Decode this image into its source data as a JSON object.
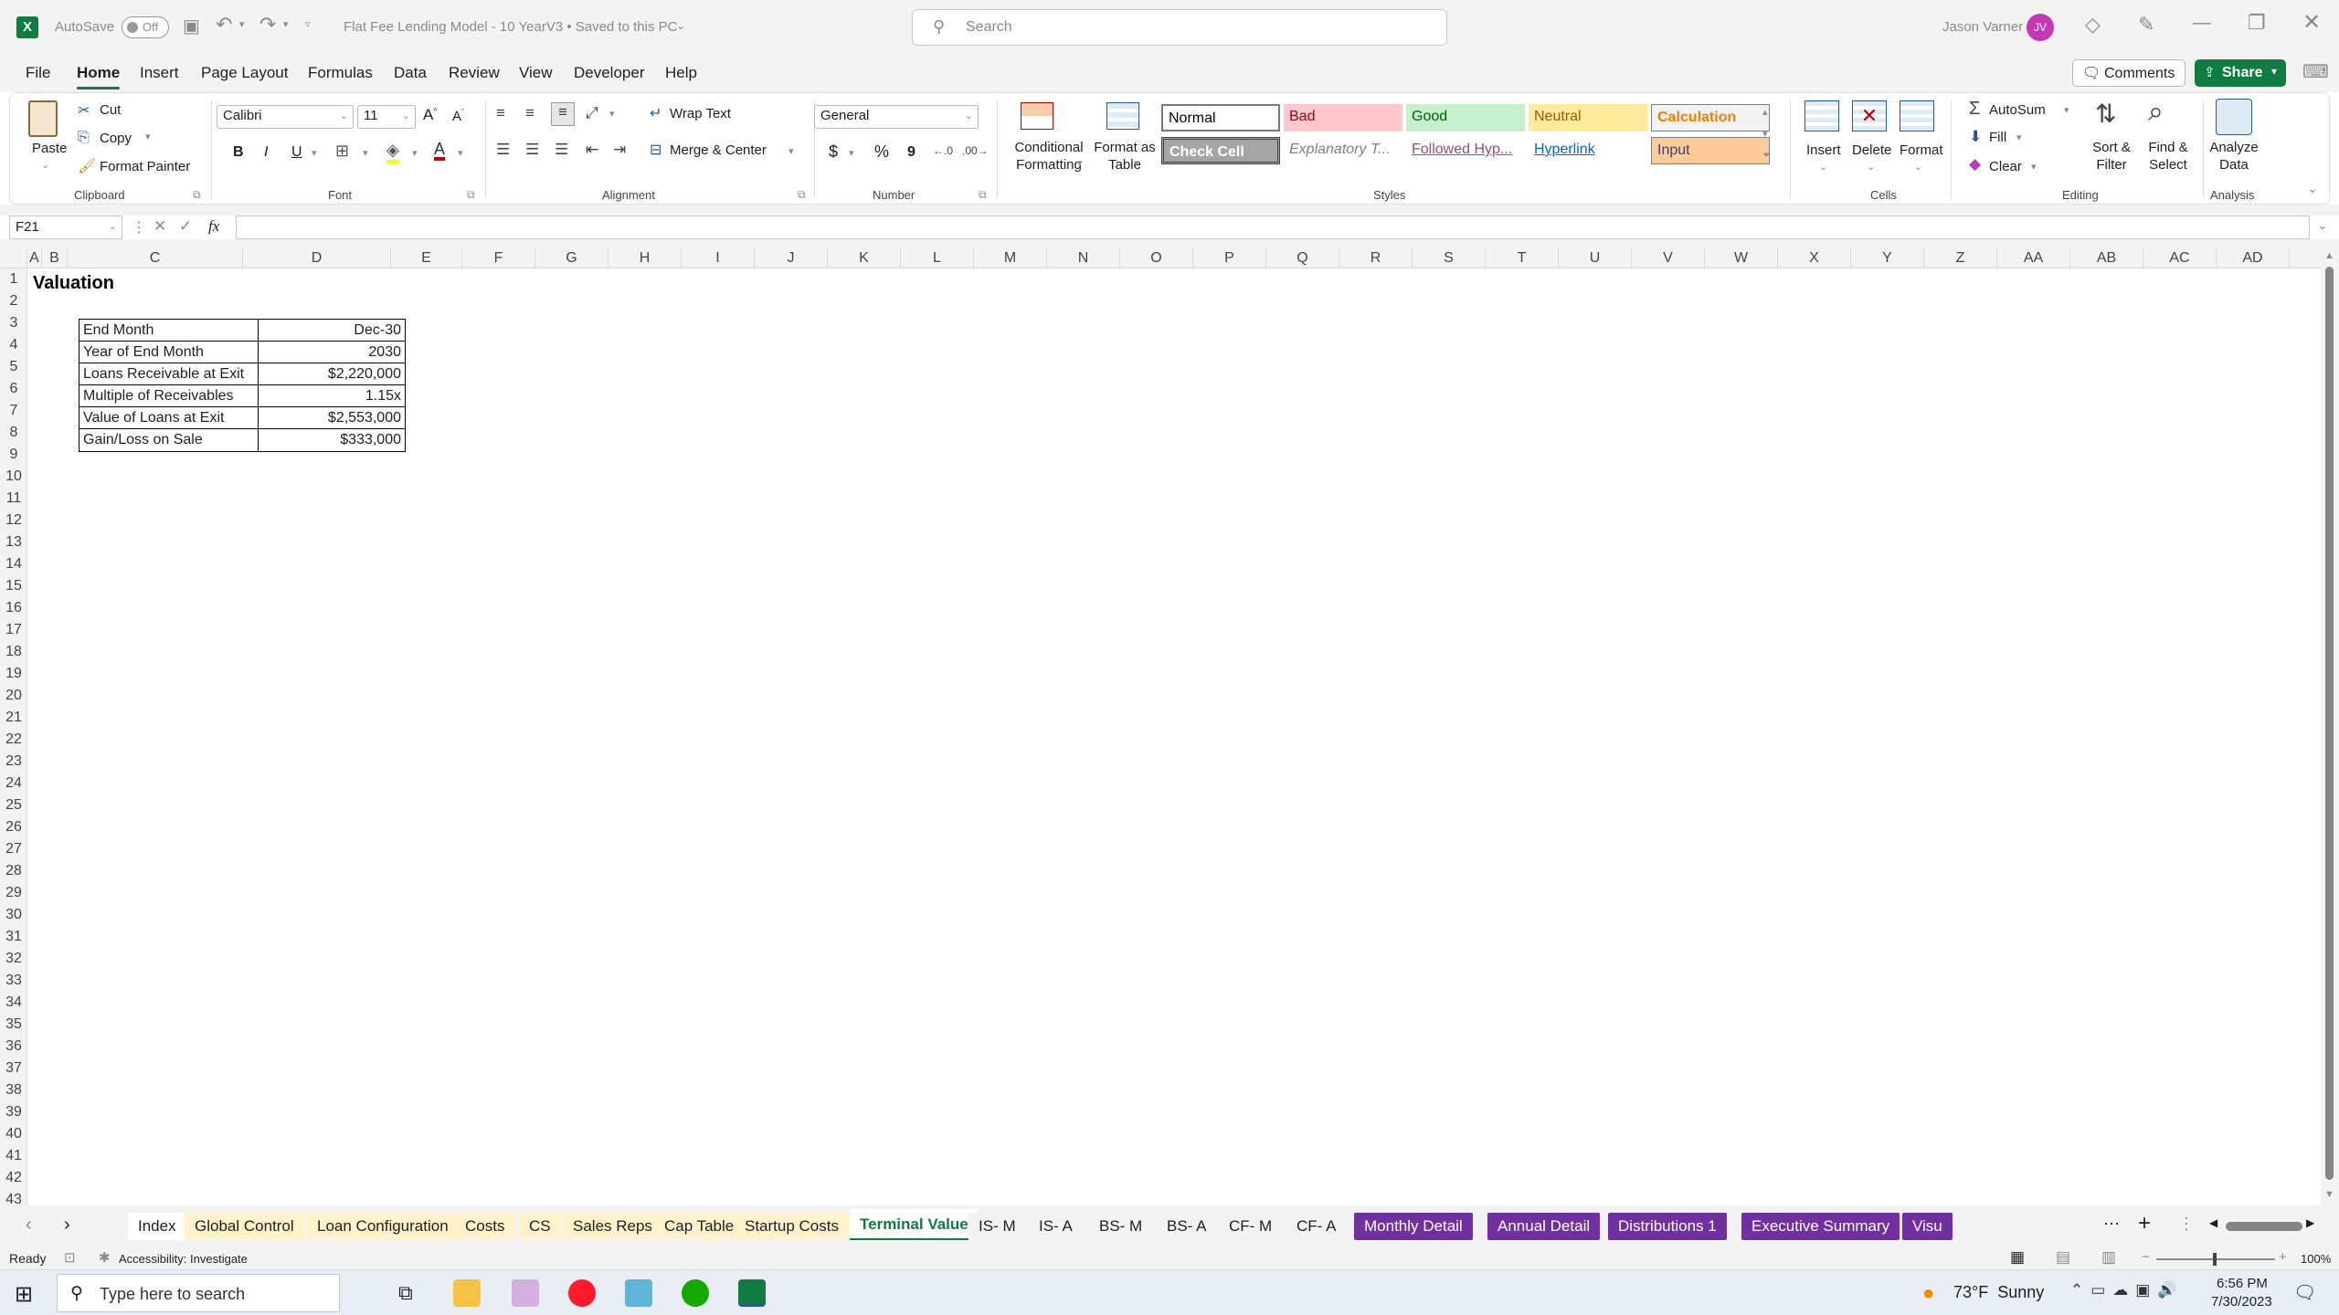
{
  "titlebar": {
    "autosave_label": "AutoSave",
    "autosave_state": "Off",
    "doc_title": "Flat Fee Lending Model - 10 YearV3 • Saved to this PC",
    "search_placeholder": "Search",
    "user_name": "Jason Varner",
    "user_initials": "JV"
  },
  "menu": {
    "items": [
      "File",
      "Home",
      "Insert",
      "Page Layout",
      "Formulas",
      "Data",
      "Review",
      "View",
      "Developer",
      "Help"
    ],
    "active": "Home",
    "comments_label": "Comments",
    "share_label": "Share"
  },
  "ribbon": {
    "clipboard": {
      "paste": "Paste",
      "cut": "Cut",
      "copy": "Copy",
      "format_painter": "Format Painter",
      "group": "Clipboard"
    },
    "font": {
      "name": "Calibri",
      "size": "11",
      "group": "Font",
      "bold": "B",
      "italic": "I",
      "underline": "U"
    },
    "alignment": {
      "wrap": "Wrap Text",
      "merge": "Merge & Center",
      "group": "Alignment"
    },
    "number": {
      "format": "General",
      "group": "Number",
      "currency": "$",
      "percent": "%",
      "comma": "9"
    },
    "styles": {
      "cond": "Conditional Formatting",
      "table": "Format as Table",
      "group": "Styles",
      "cells": [
        {
          "label": "Normal",
          "bg": "#ffffff",
          "fg": "#000000"
        },
        {
          "label": "Bad",
          "bg": "#ffc7ce",
          "fg": "#9c0006"
        },
        {
          "label": "Good",
          "bg": "#c6efce",
          "fg": "#006100"
        },
        {
          "label": "Neutral",
          "bg": "#ffeb9c",
          "fg": "#9c5700"
        },
        {
          "label": "Calculation",
          "bg": "#f2f2f2",
          "fg": "#fa7d00"
        },
        {
          "label": "Check Cell",
          "bg": "#a5a5a5",
          "fg": "#ffffff"
        },
        {
          "label": "Explanatory T...",
          "bg": "#ffffff",
          "fg": "#7f7f7f"
        },
        {
          "label": "Followed Hyp...",
          "bg": "#ffffff",
          "fg": "#954f72"
        },
        {
          "label": "Hyperlink",
          "bg": "#ffffff",
          "fg": "#0563c1"
        },
        {
          "label": "Input",
          "bg": "#ffcc99",
          "fg": "#3f3f76"
        }
      ]
    },
    "cells": {
      "insert": "Insert",
      "delete": "Delete",
      "format": "Format",
      "group": "Cells"
    },
    "editing": {
      "autosum": "AutoSum",
      "fill": "Fill",
      "clear": "Clear",
      "sort": "Sort & Filter",
      "find": "Find & Select",
      "group": "Editing"
    },
    "analysis": {
      "analyze": "Analyze Data",
      "group": "Analysis"
    }
  },
  "formula_bar": {
    "name_box": "F21",
    "fx": "fx",
    "value": ""
  },
  "columns": [
    "A",
    "B",
    "C",
    "D",
    "E",
    "F",
    "G",
    "H",
    "I",
    "J",
    "K",
    "L",
    "M",
    "N",
    "O",
    "P",
    "Q",
    "R",
    "S",
    "T",
    "U",
    "V",
    "W",
    "X",
    "Y",
    "Z",
    "AA",
    "AB",
    "AC",
    "AD"
  ],
  "rows": [
    "1",
    "2",
    "3",
    "4",
    "5",
    "6",
    "7",
    "8",
    "9",
    "10",
    "11",
    "12",
    "13",
    "14",
    "15",
    "16",
    "17",
    "18",
    "19",
    "20",
    "21",
    "22",
    "23",
    "24",
    "25",
    "26",
    "27",
    "28",
    "29",
    "30",
    "31",
    "32",
    "33",
    "34",
    "35",
    "36",
    "37",
    "38",
    "39",
    "40",
    "41",
    "42",
    "43"
  ],
  "sheet": {
    "title": "Valuation",
    "table": [
      {
        "label": "End Month",
        "value": "Dec-30"
      },
      {
        "label": "Year of End Month",
        "value": "2030"
      },
      {
        "label": "Loans Receivable at Exit",
        "value": "$2,220,000"
      },
      {
        "label": "Multiple of Receivables",
        "value": "1.15x"
      },
      {
        "label": "Value of Loans at Exit",
        "value": "$2,553,000"
      },
      {
        "label": "Gain/Loss on Sale",
        "value": "$333,000"
      }
    ]
  },
  "tabs": [
    {
      "label": "Index",
      "color": "#ffffff",
      "fg": "#1f1f1f"
    },
    {
      "label": "Global Control",
      "color": "#fff2cc",
      "fg": "#1f1f1f"
    },
    {
      "label": "Loan Configuration",
      "color": "#fff2cc",
      "fg": "#1f1f1f"
    },
    {
      "label": "Costs",
      "color": "#fff2cc",
      "fg": "#1f1f1f"
    },
    {
      "label": "CS",
      "color": "#fff2cc",
      "fg": "#1f1f1f"
    },
    {
      "label": "Sales Reps",
      "color": "#fff2cc",
      "fg": "#1f1f1f"
    },
    {
      "label": "Cap Table",
      "color": "#fff2cc",
      "fg": "#1f1f1f"
    },
    {
      "label": "Startup Costs",
      "color": "#fff2cc",
      "fg": "#1f1f1f"
    },
    {
      "label": "Terminal Value",
      "color": "#ffffff",
      "fg": "#107c41",
      "active": true
    },
    {
      "label": "IS- M",
      "color": "#f3f3f3",
      "fg": "#1f1f1f"
    },
    {
      "label": "IS- A",
      "color": "#f3f3f3",
      "fg": "#1f1f1f"
    },
    {
      "label": "BS- M",
      "color": "#f3f3f3",
      "fg": "#1f1f1f"
    },
    {
      "label": "BS- A",
      "color": "#f3f3f3",
      "fg": "#1f1f1f"
    },
    {
      "label": "CF- M",
      "color": "#f3f3f3",
      "fg": "#1f1f1f"
    },
    {
      "label": "CF- A",
      "color": "#f3f3f3",
      "fg": "#1f1f1f"
    },
    {
      "label": "Monthly Detail",
      "color": "#7030a0",
      "fg": "#ffffff"
    },
    {
      "label": "Annual Detail",
      "color": "#7030a0",
      "fg": "#ffffff"
    },
    {
      "label": "Distributions 1",
      "color": "#7030a0",
      "fg": "#ffffff"
    },
    {
      "label": "Executive Summary",
      "color": "#7030a0",
      "fg": "#ffffff"
    },
    {
      "label": "Visu",
      "color": "#7030a0",
      "fg": "#ffffff"
    }
  ],
  "status": {
    "ready": "Ready",
    "accessibility": "Accessibility: Investigate",
    "zoom": "100%"
  },
  "taskbar": {
    "search_placeholder": "Type here to search",
    "weather": "73°F  Sunny",
    "time": "6:56 PM",
    "date": "7/30/2023"
  },
  "colors": {
    "excel_green": "#217346",
    "share_green": "#107c41",
    "avatar": "#c239b3",
    "purple_tab": "#7030a0"
  }
}
